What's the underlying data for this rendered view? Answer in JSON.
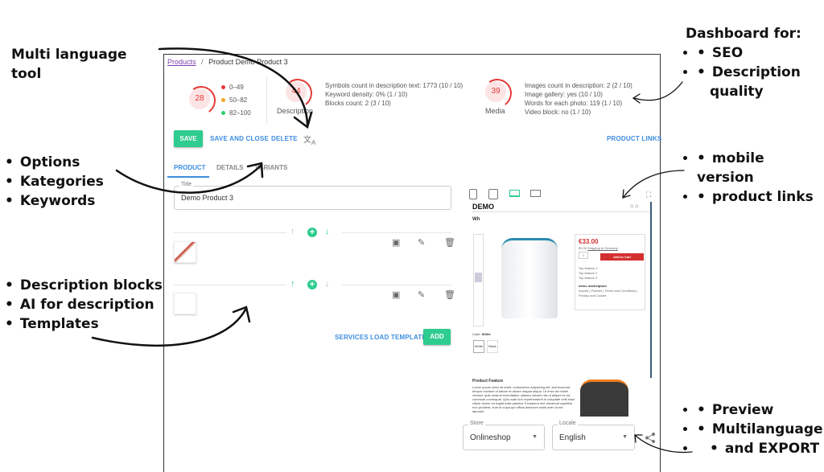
{
  "annotations": {
    "multi_language": "Multi language tool",
    "left_group_1": [
      "Options",
      "Kategories",
      "Keywords"
    ],
    "left_group_2": [
      "Description blocks",
      "AI for description",
      "Templates"
    ],
    "dashboard_title": "Dashboard for:",
    "dashboard_items": [
      "SEO",
      "Description quality"
    ],
    "right_group_2": [
      "mobile version",
      "product links"
    ],
    "right_group_3": [
      "Preview",
      "Multilanguage",
      "and EXPORT"
    ]
  },
  "breadcrumb": {
    "link": "Products",
    "separator": "/",
    "current": "Product Demo Product 3"
  },
  "scores": {
    "overall": "28",
    "legend": [
      {
        "label": "0–49",
        "color": "#e53935"
      },
      {
        "label": "50–82",
        "color": "#f5a623"
      },
      {
        "label": "82–100",
        "color": "#2ecc71"
      }
    ],
    "description": {
      "value": "44",
      "label": "Description",
      "details": [
        "Symbols count in description text: 1773 (10 / 10)",
        "Keyword density: 0% (1 / 10)",
        "Blocks count: 2 (3 / 10)"
      ]
    },
    "media": {
      "value": "39",
      "label": "Media",
      "details": [
        "Images count in description: 2 (2 / 10)",
        "Image gallery: yes (10 / 10)",
        "Words for each photo: 119 (1 / 10)",
        "Video block: no (1 / 10)"
      ]
    }
  },
  "toolbar": {
    "save": "SAVE",
    "save_close": "SAVE AND CLOSE",
    "delete": "DELETE",
    "product_links": "PRODUCT LINKS"
  },
  "tabs": [
    {
      "label": "PRODUCT",
      "active": true
    },
    {
      "label": "DETAILS"
    },
    {
      "label": "VARIANTS"
    }
  ],
  "title_field": {
    "label": "Title",
    "value": "Demo Product 3"
  },
  "bottom_actions": {
    "services": "SERVICES",
    "load_template": "LOAD TEMPLATE",
    "add": "ADD"
  },
  "preview": {
    "logo": "DEMO",
    "heading": "Wh",
    "price": "€33.00",
    "old_price": "€0.00",
    "shipping": "Shipping to Germany",
    "qty": "1",
    "add_to_cart": "Add to Cart",
    "features": [
      "Top feature 1",
      "Top feature 2",
      "Top feature 3"
    ],
    "seller": "demo marketplace",
    "links": "Imprint | Policies | Terms and Conditions | Privacy and Cookie",
    "color_label": "Color:",
    "color_value": "White",
    "variants": [
      "White",
      "Black"
    ],
    "feature_title": "Product Feature",
    "feature_text": "Lorem ipsum dolor sit amet, consectetur adipiscing elit, sed eiusmod tempor incidunt ut labore et dolore magna aliqua. Ut enim ad minim veniam, quis nostrud exercitation ullamco laboris nisi ut aliquid ex ea commodi consequat. Quis aute iure reprehenderit in voluptate velit esse cillum dolore eu fugiat nulla pariatur. Excepteur sint obcaecat cupiditat non proident, sunt in culpa qui officia deserunt mollit anim id est laborum."
  },
  "store_select": {
    "label": "Store",
    "value": "Onlineshop"
  },
  "locale_select": {
    "label": "Locale",
    "value": "English"
  },
  "colors": {
    "accent": "#2ecc8f",
    "link": "#3d8de0",
    "score": "#e53935"
  }
}
